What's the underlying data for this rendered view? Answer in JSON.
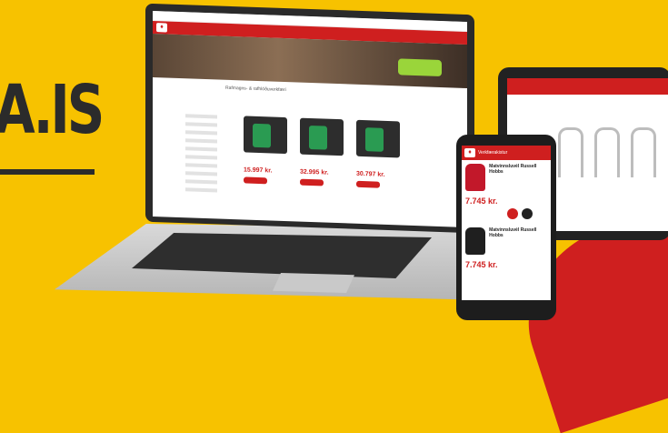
{
  "brand": {
    "text": "A.IS"
  },
  "laptop": {
    "breadcrumb": "Rafmagns- & rafhlöðuverkfæri",
    "products": [
      {
        "price": "15.997 kr."
      },
      {
        "price": "32.995 kr."
      },
      {
        "price": "30.797 kr."
      }
    ]
  },
  "phone": {
    "tab": "Verkfærakistur",
    "items": [
      {
        "title": "Matvinnsluvél Russell Hobbs",
        "price": "7.745 kr."
      },
      {
        "title": "Matvinnsluvél Russell Hobbs",
        "price": "7.745 kr."
      }
    ]
  },
  "colors": {
    "accent": "#cf1f1f",
    "background": "#f7c200"
  }
}
